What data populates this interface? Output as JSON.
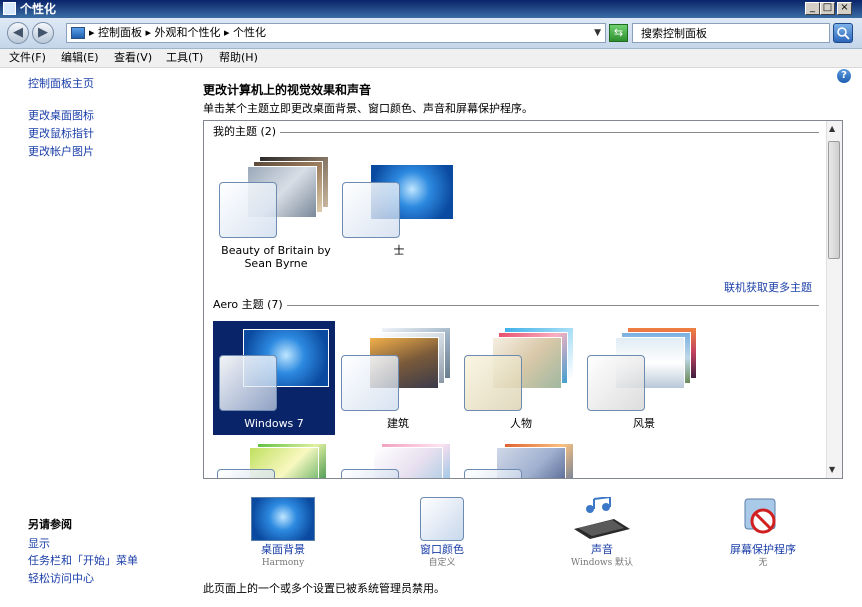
{
  "window": {
    "title": "个性化"
  },
  "address": {
    "path": "▸ 控制面板 ▸ 外观和个性化 ▸ 个性化",
    "search_placeholder": "搜索控制面板"
  },
  "menu": [
    "文件(F)",
    "编辑(E)",
    "查看(V)",
    "工具(T)",
    "帮助(H)"
  ],
  "sidebar": {
    "home": "控制面板主页",
    "links": [
      "更改桌面图标",
      "更改鼠标指针",
      "更改帐户图片"
    ],
    "see_also_title": "另请参阅",
    "see_also": [
      "显示",
      "任务栏和「开始」菜单",
      "轻松访问中心"
    ]
  },
  "main": {
    "heading": "更改计算机上的视觉效果和声音",
    "subtext": "单击某个主题立即更改桌面背景、窗口颜色、声音和屏幕保护程序。",
    "my_themes_label": "我的主题 (2)",
    "my_themes": [
      {
        "name": "Beauty of Britain by Sean Byrne"
      },
      {
        "name": "士"
      }
    ],
    "more_themes_link": "联机获取更多主题",
    "aero_label": "Aero 主题 (7)",
    "aero_themes": [
      {
        "name": "Windows 7",
        "selected": true
      },
      {
        "name": "建筑"
      },
      {
        "name": "人物"
      },
      {
        "name": "风景"
      }
    ]
  },
  "bottom": [
    {
      "label": "桌面背景",
      "sub": "Harmony"
    },
    {
      "label": "窗口颜色",
      "sub": "自定义"
    },
    {
      "label": "声音",
      "sub": "Windows 默认"
    },
    {
      "label": "屏幕保护程序",
      "sub": "无"
    }
  ],
  "footer": "此页面上的一个或多个设置已被系统管理员禁用。",
  "colors": {
    "title_bar": "#0a246a",
    "link": "#1a3ea8",
    "selection": "#0a246a"
  }
}
